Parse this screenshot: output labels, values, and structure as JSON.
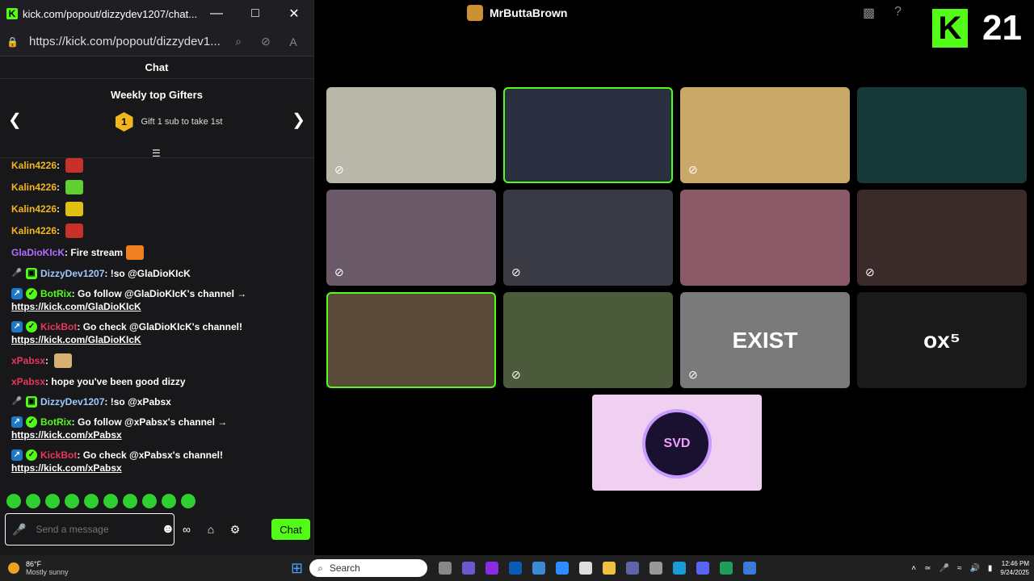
{
  "popup": {
    "title": "kick.com/popout/dizzydev1207/chat...",
    "url": "https://kick.com/popout/dizzydev1...",
    "chat_label": "Chat"
  },
  "gifters": {
    "title": "Weekly top Gifters",
    "rank": "1",
    "prompt": "Gift 1 sub to take 1st"
  },
  "messages": [
    {
      "user": "Kalin4226",
      "color": "#f2b51d",
      "text": "",
      "badges": [],
      "emote": "#c8302a"
    },
    {
      "user": "Kalin4226",
      "color": "#f2b51d",
      "text": "",
      "badges": [],
      "emote": "#5fd02f"
    },
    {
      "user": "Kalin4226",
      "color": "#f2b51d",
      "text": "",
      "badges": [],
      "emote": "#e0c010"
    },
    {
      "user": "Kalin4226",
      "color": "#f2b51d",
      "text": "",
      "badges": [],
      "emote": "#c8302a"
    },
    {
      "user": "GlaDioKIcK",
      "color": "#b46cff",
      "text": "Fire stream",
      "badges": [],
      "emote": "#f08020"
    },
    {
      "user": "DizzyDev1207",
      "color": "#9ecbff",
      "text": "!so @GlaDioKIcK",
      "badges": [
        "mic",
        "gift"
      ],
      "emote": ""
    },
    {
      "user": "BotRix",
      "color": "#53fc18",
      "text": "Go follow @GlaDioKIcK's channel →",
      "link": "https://kick.com/GlaDioKIcK",
      "badges": [
        "bot",
        "ver"
      ],
      "emote": ""
    },
    {
      "user": "KickBot",
      "color": "#e8365d",
      "text": "Go check @GlaDioKIcK's channel!",
      "link": "https://kick.com/GlaDioKIcK",
      "badges": [
        "bot",
        "ver"
      ],
      "emote": ""
    },
    {
      "user": "xPabsx",
      "color": "#e8365d",
      "text": "",
      "badges": [],
      "emote": "#d8b070"
    },
    {
      "user": "xPabsx",
      "color": "#e8365d",
      "text": "hope you've been good dizzy",
      "badges": [],
      "emote": ""
    },
    {
      "user": "DizzyDev1207",
      "color": "#9ecbff",
      "text": "!so @xPabsx",
      "badges": [
        "mic",
        "gift"
      ],
      "emote": ""
    },
    {
      "user": "BotRix",
      "color": "#53fc18",
      "text": "Go follow @xPabsx's channel →",
      "link": "https://kick.com/xPabsx",
      "badges": [
        "bot",
        "ver"
      ],
      "emote": ""
    },
    {
      "user": "KickBot",
      "color": "#e8365d",
      "text": "Go check @xPabsx's channel!",
      "link": "https://kick.com/xPabsx",
      "badges": [
        "bot",
        "ver"
      ],
      "emote": ""
    }
  ],
  "input": {
    "placeholder": "Send a message",
    "chat_button": "Chat"
  },
  "stream": {
    "streamer": "MrButtaBrown",
    "overlay_number": "21",
    "tiles": [
      {
        "bg": "#b9b6aa",
        "muted": true,
        "active": false,
        "logo": ""
      },
      {
        "bg": "#2a3040",
        "muted": false,
        "active": true,
        "logo": ""
      },
      {
        "bg": "#c9a86a",
        "muted": true,
        "active": false,
        "logo": ""
      },
      {
        "bg": "#163838",
        "muted": false,
        "active": false,
        "logo": ""
      },
      {
        "bg": "#6a5a68",
        "muted": true,
        "active": false,
        "logo": ""
      },
      {
        "bg": "#3a3a44",
        "muted": true,
        "active": false,
        "logo": ""
      },
      {
        "bg": "#8a5a68",
        "muted": false,
        "active": false,
        "logo": ""
      },
      {
        "bg": "#3a2a2a",
        "muted": true,
        "active": false,
        "logo": ""
      },
      {
        "bg": "#5a4a3a",
        "muted": false,
        "active": true,
        "logo": ""
      },
      {
        "bg": "#4a5a3a",
        "muted": true,
        "active": false,
        "logo": ""
      },
      {
        "bg": "#7a7a7a",
        "muted": true,
        "active": false,
        "logo": "EXIST"
      },
      {
        "bg": "#1a1a1a",
        "muted": false,
        "active": false,
        "logo": "ox⁵"
      }
    ],
    "bottom_tile_logo": "SVD"
  },
  "taskbar": {
    "temp": "86°F",
    "weather": "Mostly sunny",
    "search": "Search",
    "time": "12:46 PM",
    "date": "9/24/2025"
  }
}
